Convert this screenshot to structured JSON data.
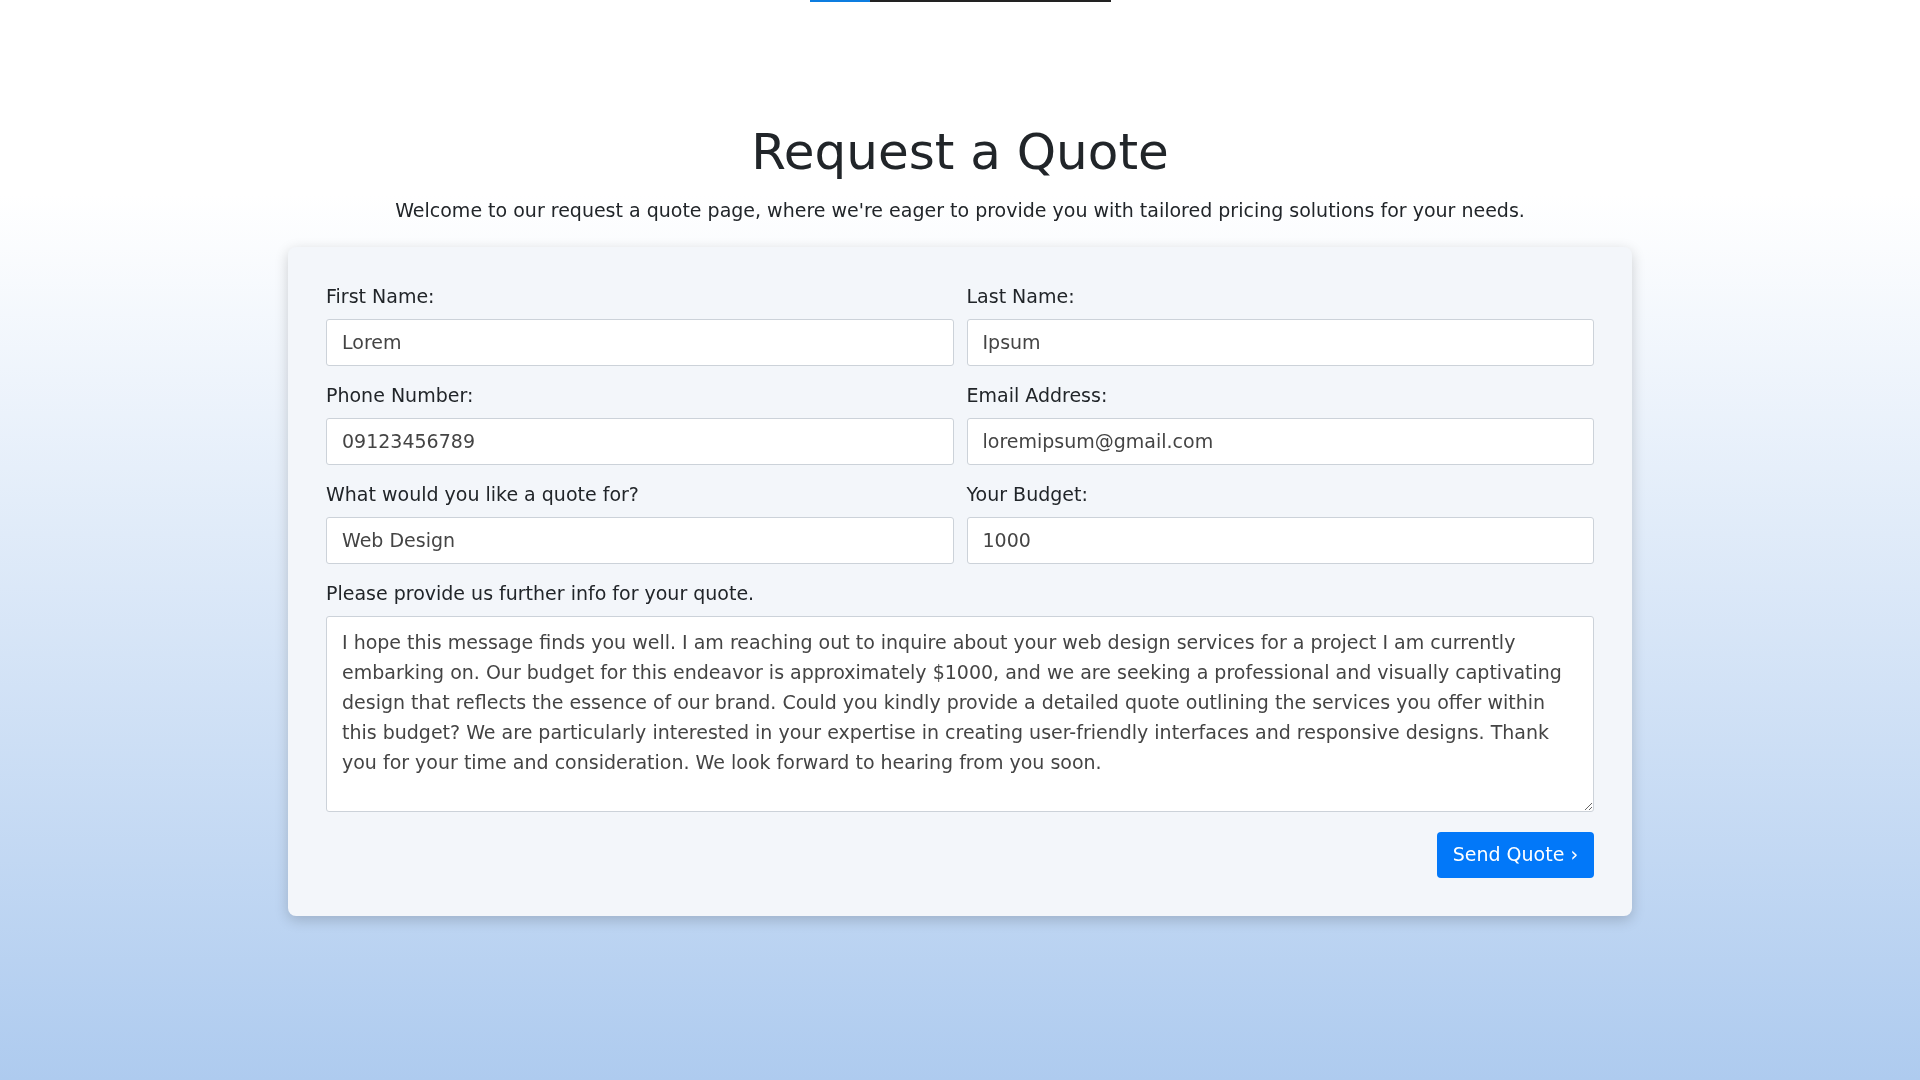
{
  "progress": {
    "level": 0.2
  },
  "title": "Request a Quote",
  "subtitle": "Welcome to our request a quote page, where we're eager to provide you with tailored pricing solutions for your needs.",
  "fields": [
    {
      "label": "First Name:",
      "value": "Lorem"
    },
    {
      "label": "Last Name:",
      "value": "Ipsum"
    },
    {
      "label": "Phone Number:",
      "value": "09123456789"
    },
    {
      "label": "Email Address:",
      "value": "loremipsum@gmail.com"
    },
    {
      "label": "What would you like a quote for?",
      "value": "Web Design"
    },
    {
      "label": "Your Budget:",
      "value": "1000"
    }
  ],
  "message": {
    "label": "Please provide us further info for your quote.",
    "value": "I hope this message finds you well. I am reaching out to inquire about your web design services for a project I am currently embarking on. Our budget for this endeavor is approximately $1000, and we are seeking a professional and visually captivating design that reflects the essence of our brand. Could you kindly provide a detailed quote outlining the services you offer within this budget? We are particularly interested in your expertise in creating user-friendly interfaces and responsive designs. Thank you for your time and consideration. We look forward to hearing from you soon."
  },
  "submit": "Send Quote ›"
}
